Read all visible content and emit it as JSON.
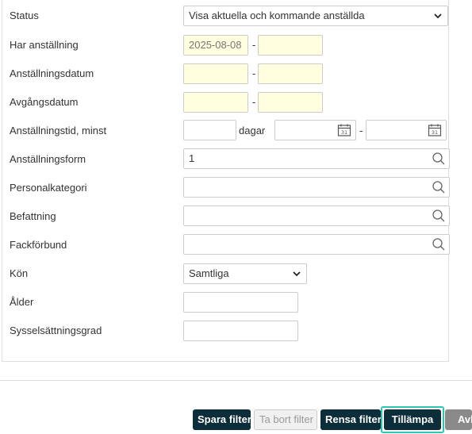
{
  "filters": {
    "status": {
      "label": "Status",
      "value": "Visa aktuella och kommande anställda"
    },
    "employment": {
      "label": "Har anställning",
      "from": "2025-08-08",
      "to": "",
      "separator": "-"
    },
    "employment_date": {
      "label": "Anställningsdatum",
      "from": "",
      "to": "",
      "separator": "-"
    },
    "departure_date": {
      "label": "Avgångsdatum",
      "from": "",
      "to": "",
      "separator": "-"
    },
    "tenure_min": {
      "label": "Anställningstid, minst",
      "days_value": "",
      "days_unit": "dagar",
      "from": "",
      "to": "",
      "separator": "-"
    },
    "employment_form": {
      "label": "Anställningsform",
      "value": "1"
    },
    "staff_category": {
      "label": "Personalkategori",
      "value": ""
    },
    "position": {
      "label": "Befattning",
      "value": ""
    },
    "union": {
      "label": "Fackförbund",
      "value": ""
    },
    "gender": {
      "label": "Kön",
      "value": "Samtliga"
    },
    "age": {
      "label": "Ålder",
      "value": ""
    },
    "employment_rate": {
      "label": "Sysselsättningsgrad",
      "value": ""
    }
  },
  "footer": {
    "save_filter": "Spara filter",
    "delete_filter": "Ta bort filter",
    "clear_filter": "Rensa filter",
    "apply": "Tillämpa",
    "cancel": "Avbryt"
  },
  "icons": {
    "chevron": "chevron-down-icon",
    "lookup": "search-icon",
    "calendar": "calendar-icon"
  },
  "colors": {
    "date_field_bg": "#ffffe0",
    "primary_button": "#0c2d3a",
    "focus_ring": "#2ec4b6",
    "cancel_button": "#8a8a8a"
  }
}
